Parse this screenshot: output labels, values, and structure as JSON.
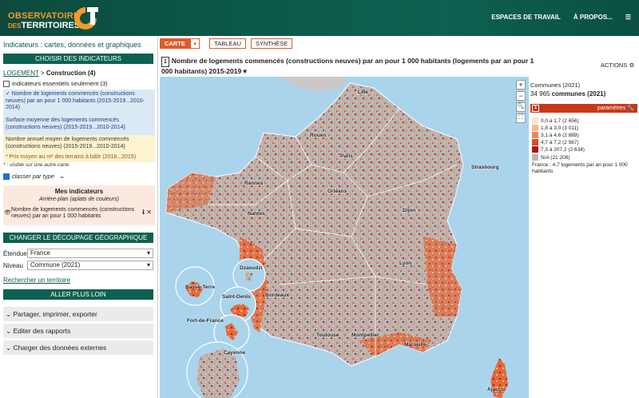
{
  "header": {
    "logo_line1": "OBSERVATOIRE",
    "logo_line2_prefix": "DES",
    "logo_line2": "TERRITOIRES",
    "logo_mark": "CT",
    "nav": [
      "ESPACES DE TRAVAIL",
      "À PROPOS...",
      "☰"
    ]
  },
  "left": {
    "title": "Indicateurs : cartes, données et graphiques",
    "choose_bar": "CHOISIR DES INDICATEURS",
    "breadcrumb_root": "LOGEMENT",
    "breadcrumb_sep": " > ",
    "breadcrumb_leaf": "Construction (4)",
    "essential_only": "indicateurs essentiels seulement (3)",
    "indicators": [
      "✓ Nombre de logements commencés (constructions neuves) par an pour 1 000 habitants (2015-2019...2010-2014)",
      "Surface moyenne des logements commencés (constructions neuves) (2015-2019...2010-2014)",
      "Nombre annuel moyen de logements commencés (constructions neuves) (2015-2019...2010-2014)",
      "* Prix moyen au m² des terrains à bâtir (2018...2015)"
    ],
    "note": "* : visible sur une autre carte",
    "class_by_type": "classer par type",
    "my_indicators": {
      "title": "Mes indicateurs",
      "subtitle": "Arrière-plan (aplats de couleurs)",
      "item": "Nombre de logements commencés (constructions neuves) par an pour 1 000 habitants"
    },
    "change_bar": "CHANGER LE DÉCOUPAGE GÉOGRAPHIQUE",
    "extent_label": "Étendue",
    "extent_value": "France",
    "level_label": "Niveau",
    "level_value": "Commune (2021)",
    "search_link": "Rechercher un territoire",
    "more_bar": "ALLER PLUS LOIN",
    "accordions": [
      "Partager, imprimer, exporter",
      "Editer des rapports",
      "Charger des données externes"
    ]
  },
  "tabs": {
    "carte": "CARTE",
    "plus": "+",
    "tableau": "TABLEAU",
    "synthese": "SYNTHÈSE"
  },
  "map": {
    "title_num": "1",
    "title": "Nombre de logements commencés (constructions neuves) par an pour 1 000 habitants (logements par an pour 1 000 habitants)",
    "title_period": "2015-2019",
    "actions": "ACTIONS",
    "cities": [
      "Lille",
      "Rouen",
      "Paris",
      "Strasbourg",
      "Rennes",
      "Orléans",
      "Nantes",
      "Dijon",
      "Lyon",
      "Bordeaux",
      "Toulouse",
      "Montpellier",
      "Marseille",
      "Ajaccio",
      "Basse-Terre",
      "Dzaoudzi",
      "Fort-de-France",
      "Saint-Denis",
      "Cayenne"
    ],
    "zoom_controls": [
      "+",
      "−",
      "🔍",
      "⛶"
    ]
  },
  "legend": {
    "unit_label": "Communes (2021)",
    "count": "34 965",
    "count_suffix": "communes (2021)",
    "bar_num": "1",
    "bar_label": "paramètres",
    "classes": [
      {
        "label": "0,0 à 1,7 (2 656)",
        "color": "#fde3cf"
      },
      {
        "label": "1,8 à 3,0 (3 011)",
        "color": "#f9b98f"
      },
      {
        "label": "3,1 à 4,6 (2 889)",
        "color": "#f2854f"
      },
      {
        "label": "4,7 à 7,2 (2 567)",
        "color": "#dd4a26"
      },
      {
        "label": "7,3 à 207,2 (2 634)",
        "color": "#b0180f"
      },
      {
        "label": "N/A (21 208)",
        "color": "#b8b8b8"
      }
    ],
    "footer": "France : 4,7 logements par an pour 1 000 habitants"
  }
}
